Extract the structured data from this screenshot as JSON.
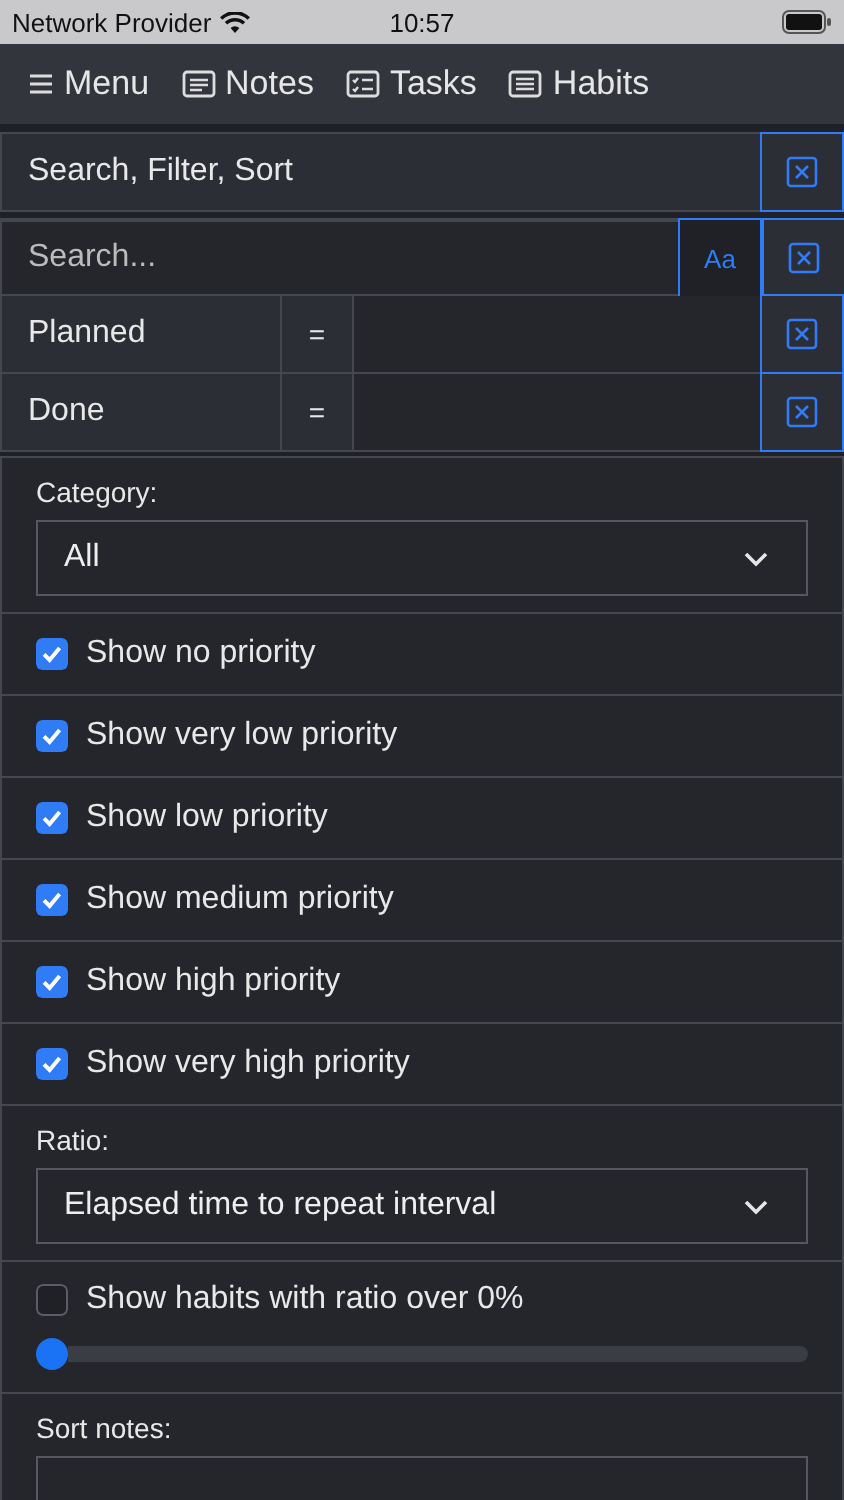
{
  "status_bar": {
    "carrier": "Network Provider",
    "time": "10:57"
  },
  "nav": [
    {
      "kind": "menu",
      "label": "Menu"
    },
    {
      "kind": "notes",
      "label": "Notes"
    },
    {
      "kind": "tasks",
      "label": "Tasks"
    },
    {
      "kind": "habits",
      "label": "Habits"
    }
  ],
  "panel_header": {
    "title": "Search, Filter, Sort"
  },
  "search": {
    "placeholder": "Search...",
    "case_button": "Aa"
  },
  "filters": [
    {
      "label": "Planned",
      "operator": "="
    },
    {
      "label": "Done",
      "operator": "="
    }
  ],
  "category": {
    "label": "Category:",
    "value": "All"
  },
  "priorities": [
    {
      "label": "Show no priority",
      "checked": true
    },
    {
      "label": "Show very low priority",
      "checked": true
    },
    {
      "label": "Show low priority",
      "checked": true
    },
    {
      "label": "Show medium priority",
      "checked": true
    },
    {
      "label": "Show high priority",
      "checked": true
    },
    {
      "label": "Show very high priority",
      "checked": true
    }
  ],
  "ratio": {
    "label": "Ratio:",
    "value": "Elapsed time to repeat interval"
  },
  "ratio_filter": {
    "label": "Show habits with ratio over 0%",
    "checked": false,
    "level": 0
  },
  "sort": {
    "label": "Sort notes:"
  }
}
